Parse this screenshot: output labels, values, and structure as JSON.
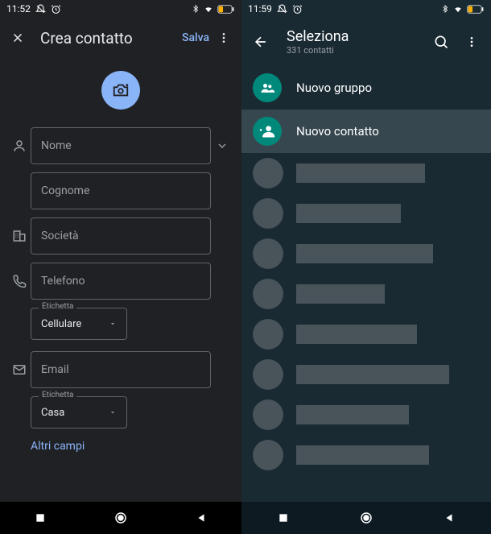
{
  "left": {
    "status_time": "11:52",
    "title": "Crea contatto",
    "save_label": "Salva",
    "fields": {
      "name_placeholder": "Nome",
      "surname_placeholder": "Cognome",
      "company_placeholder": "Società",
      "phone_placeholder": "Telefono",
      "phone_tag_label": "Etichetta",
      "phone_tag_value": "Cellulare",
      "email_placeholder": "Email",
      "email_tag_label": "Etichetta",
      "email_tag_value": "Casa"
    },
    "more_fields_label": "Altri campi"
  },
  "right": {
    "status_time": "11:59",
    "title": "Seleziona",
    "subtitle": "331 contatti",
    "new_group_label": "Nuovo gruppo",
    "new_contact_label": "Nuovo contatto",
    "placeholder_widths": [
      160,
      130,
      170,
      110,
      150,
      190,
      140,
      165
    ]
  },
  "colors": {
    "accent_blue": "#8ab4f8",
    "teal": "#00897b"
  }
}
